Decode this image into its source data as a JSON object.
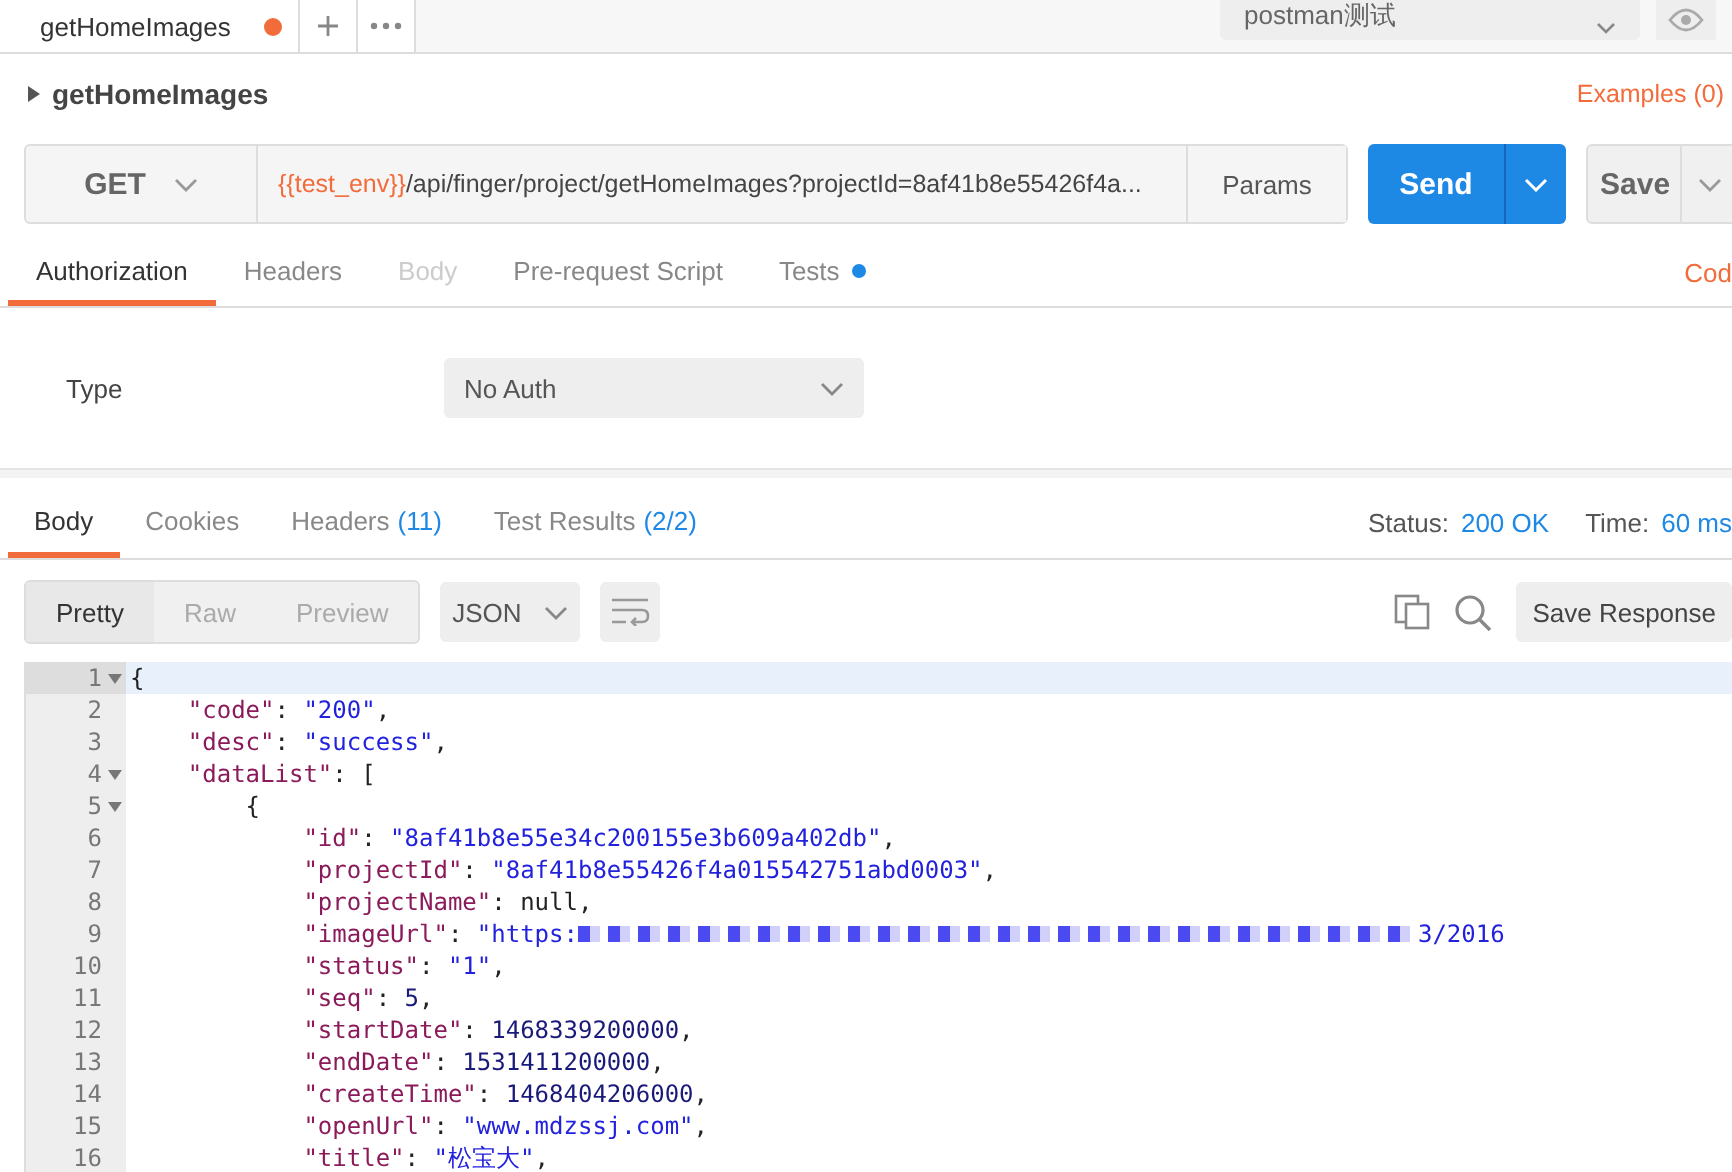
{
  "request_tabs": [
    {
      "label": "getHomeImages",
      "unsaved": true,
      "selected": true
    }
  ],
  "environment": {
    "value": "postman测试"
  },
  "request_name": "getHomeImages",
  "examples_link": "Examples (0)",
  "request": {
    "method": "GET",
    "url_variable": "{{test_env}}",
    "url_path": "/api/finger/project/getHomeImages?projectId=8af41b8e55426f4a...",
    "params_button": "Params",
    "send_button": "Send",
    "save_button": "Save"
  },
  "request_tabs_section": [
    {
      "label": "Authorization",
      "selected": true,
      "disabled": false,
      "dot": false
    },
    {
      "label": "Headers",
      "selected": false,
      "disabled": false,
      "dot": false
    },
    {
      "label": "Body",
      "selected": false,
      "disabled": true,
      "dot": false
    },
    {
      "label": "Pre-request Script",
      "selected": false,
      "disabled": false,
      "dot": false
    },
    {
      "label": "Tests",
      "selected": false,
      "disabled": false,
      "dot": true
    }
  ],
  "code_link": "Cod",
  "auth": {
    "label": "Type",
    "value": "No Auth"
  },
  "response_tabs": [
    {
      "label": "Body",
      "selected": true
    },
    {
      "label": "Cookies",
      "selected": false
    },
    {
      "label": "Headers",
      "count": "(11)",
      "selected": false
    },
    {
      "label": "Test Results",
      "count": "(2/2)",
      "selected": false
    }
  ],
  "status": {
    "label": "Status:",
    "value": "200 OK"
  },
  "time": {
    "label": "Time:",
    "value": "60 ms"
  },
  "view_modes": [
    {
      "label": "Pretty",
      "selected": true
    },
    {
      "label": "Raw",
      "selected": false
    },
    {
      "label": "Preview",
      "selected": false
    }
  ],
  "format": "JSON",
  "save_response": "Save Response",
  "code_lines": [
    {
      "number": "1",
      "fold": true,
      "tokens": [
        {
          "kind": "punct",
          "text": "{"
        }
      ]
    },
    {
      "number": "2",
      "fold": false,
      "tokens": [
        {
          "kind": "key",
          "text": "    \"code\""
        },
        {
          "kind": "punct",
          "text": ": "
        },
        {
          "kind": "str",
          "text": "\"200\""
        },
        {
          "kind": "punct",
          "text": ","
        }
      ]
    },
    {
      "number": "3",
      "fold": false,
      "tokens": [
        {
          "kind": "key",
          "text": "    \"desc\""
        },
        {
          "kind": "punct",
          "text": ": "
        },
        {
          "kind": "str",
          "text": "\"success\""
        },
        {
          "kind": "punct",
          "text": ","
        }
      ]
    },
    {
      "number": "4",
      "fold": true,
      "tokens": [
        {
          "kind": "key",
          "text": "    \"dataList\""
        },
        {
          "kind": "punct",
          "text": ": ["
        }
      ]
    },
    {
      "number": "5",
      "fold": true,
      "tokens": [
        {
          "kind": "punct",
          "text": "        {"
        }
      ]
    },
    {
      "number": "6",
      "fold": false,
      "tokens": [
        {
          "kind": "key",
          "text": "            \"id\""
        },
        {
          "kind": "punct",
          "text": ": "
        },
        {
          "kind": "str",
          "text": "\"8af41b8e55e34c200155e3b609a402db\""
        },
        {
          "kind": "punct",
          "text": ","
        }
      ]
    },
    {
      "number": "7",
      "fold": false,
      "tokens": [
        {
          "kind": "key",
          "text": "            \"projectId\""
        },
        {
          "kind": "punct",
          "text": ": "
        },
        {
          "kind": "str",
          "text": "\"8af41b8e55426f4a015542751abd0003\""
        },
        {
          "kind": "punct",
          "text": ","
        }
      ]
    },
    {
      "number": "8",
      "fold": false,
      "tokens": [
        {
          "kind": "key",
          "text": "            \"projectName\""
        },
        {
          "kind": "punct",
          "text": ": null,"
        }
      ]
    },
    {
      "number": "9",
      "fold": false,
      "tokens": [
        {
          "kind": "key",
          "text": "            \"imageUrl\""
        },
        {
          "kind": "punct",
          "text": ": "
        },
        {
          "kind": "str",
          "text": "\"https:"
        },
        {
          "kind": "redacted"
        },
        {
          "kind": "str",
          "text": "3/2016"
        }
      ]
    },
    {
      "number": "10",
      "fold": false,
      "tokens": [
        {
          "kind": "key",
          "text": "            \"status\""
        },
        {
          "kind": "punct",
          "text": ": "
        },
        {
          "kind": "str",
          "text": "\"1\""
        },
        {
          "kind": "punct",
          "text": ","
        }
      ]
    },
    {
      "number": "11",
      "fold": false,
      "tokens": [
        {
          "kind": "key",
          "text": "            \"seq\""
        },
        {
          "kind": "punct",
          "text": ": "
        },
        {
          "kind": "num",
          "text": "5"
        },
        {
          "kind": "punct",
          "text": ","
        }
      ]
    },
    {
      "number": "12",
      "fold": false,
      "tokens": [
        {
          "kind": "key",
          "text": "            \"startDate\""
        },
        {
          "kind": "punct",
          "text": ": "
        },
        {
          "kind": "num",
          "text": "1468339200000"
        },
        {
          "kind": "punct",
          "text": ","
        }
      ]
    },
    {
      "number": "13",
      "fold": false,
      "tokens": [
        {
          "kind": "key",
          "text": "            \"endDate\""
        },
        {
          "kind": "punct",
          "text": ": "
        },
        {
          "kind": "num",
          "text": "1531411200000"
        },
        {
          "kind": "punct",
          "text": ","
        }
      ]
    },
    {
      "number": "14",
      "fold": false,
      "tokens": [
        {
          "kind": "key",
          "text": "            \"createTime\""
        },
        {
          "kind": "punct",
          "text": ": "
        },
        {
          "kind": "num",
          "text": "1468404206000"
        },
        {
          "kind": "punct",
          "text": ","
        }
      ]
    },
    {
      "number": "15",
      "fold": false,
      "tokens": [
        {
          "kind": "key",
          "text": "            \"openUrl\""
        },
        {
          "kind": "punct",
          "text": ": "
        },
        {
          "kind": "str",
          "text": "\"www.mdzssj.com\""
        },
        {
          "kind": "punct",
          "text": ","
        }
      ]
    },
    {
      "number": "16",
      "fold": false,
      "tokens": [
        {
          "kind": "key",
          "text": "            \"title\""
        },
        {
          "kind": "punct",
          "text": ": "
        },
        {
          "kind": "str",
          "text": "\"松宝大\""
        },
        {
          "kind": "punct",
          "text": ","
        }
      ]
    }
  ]
}
